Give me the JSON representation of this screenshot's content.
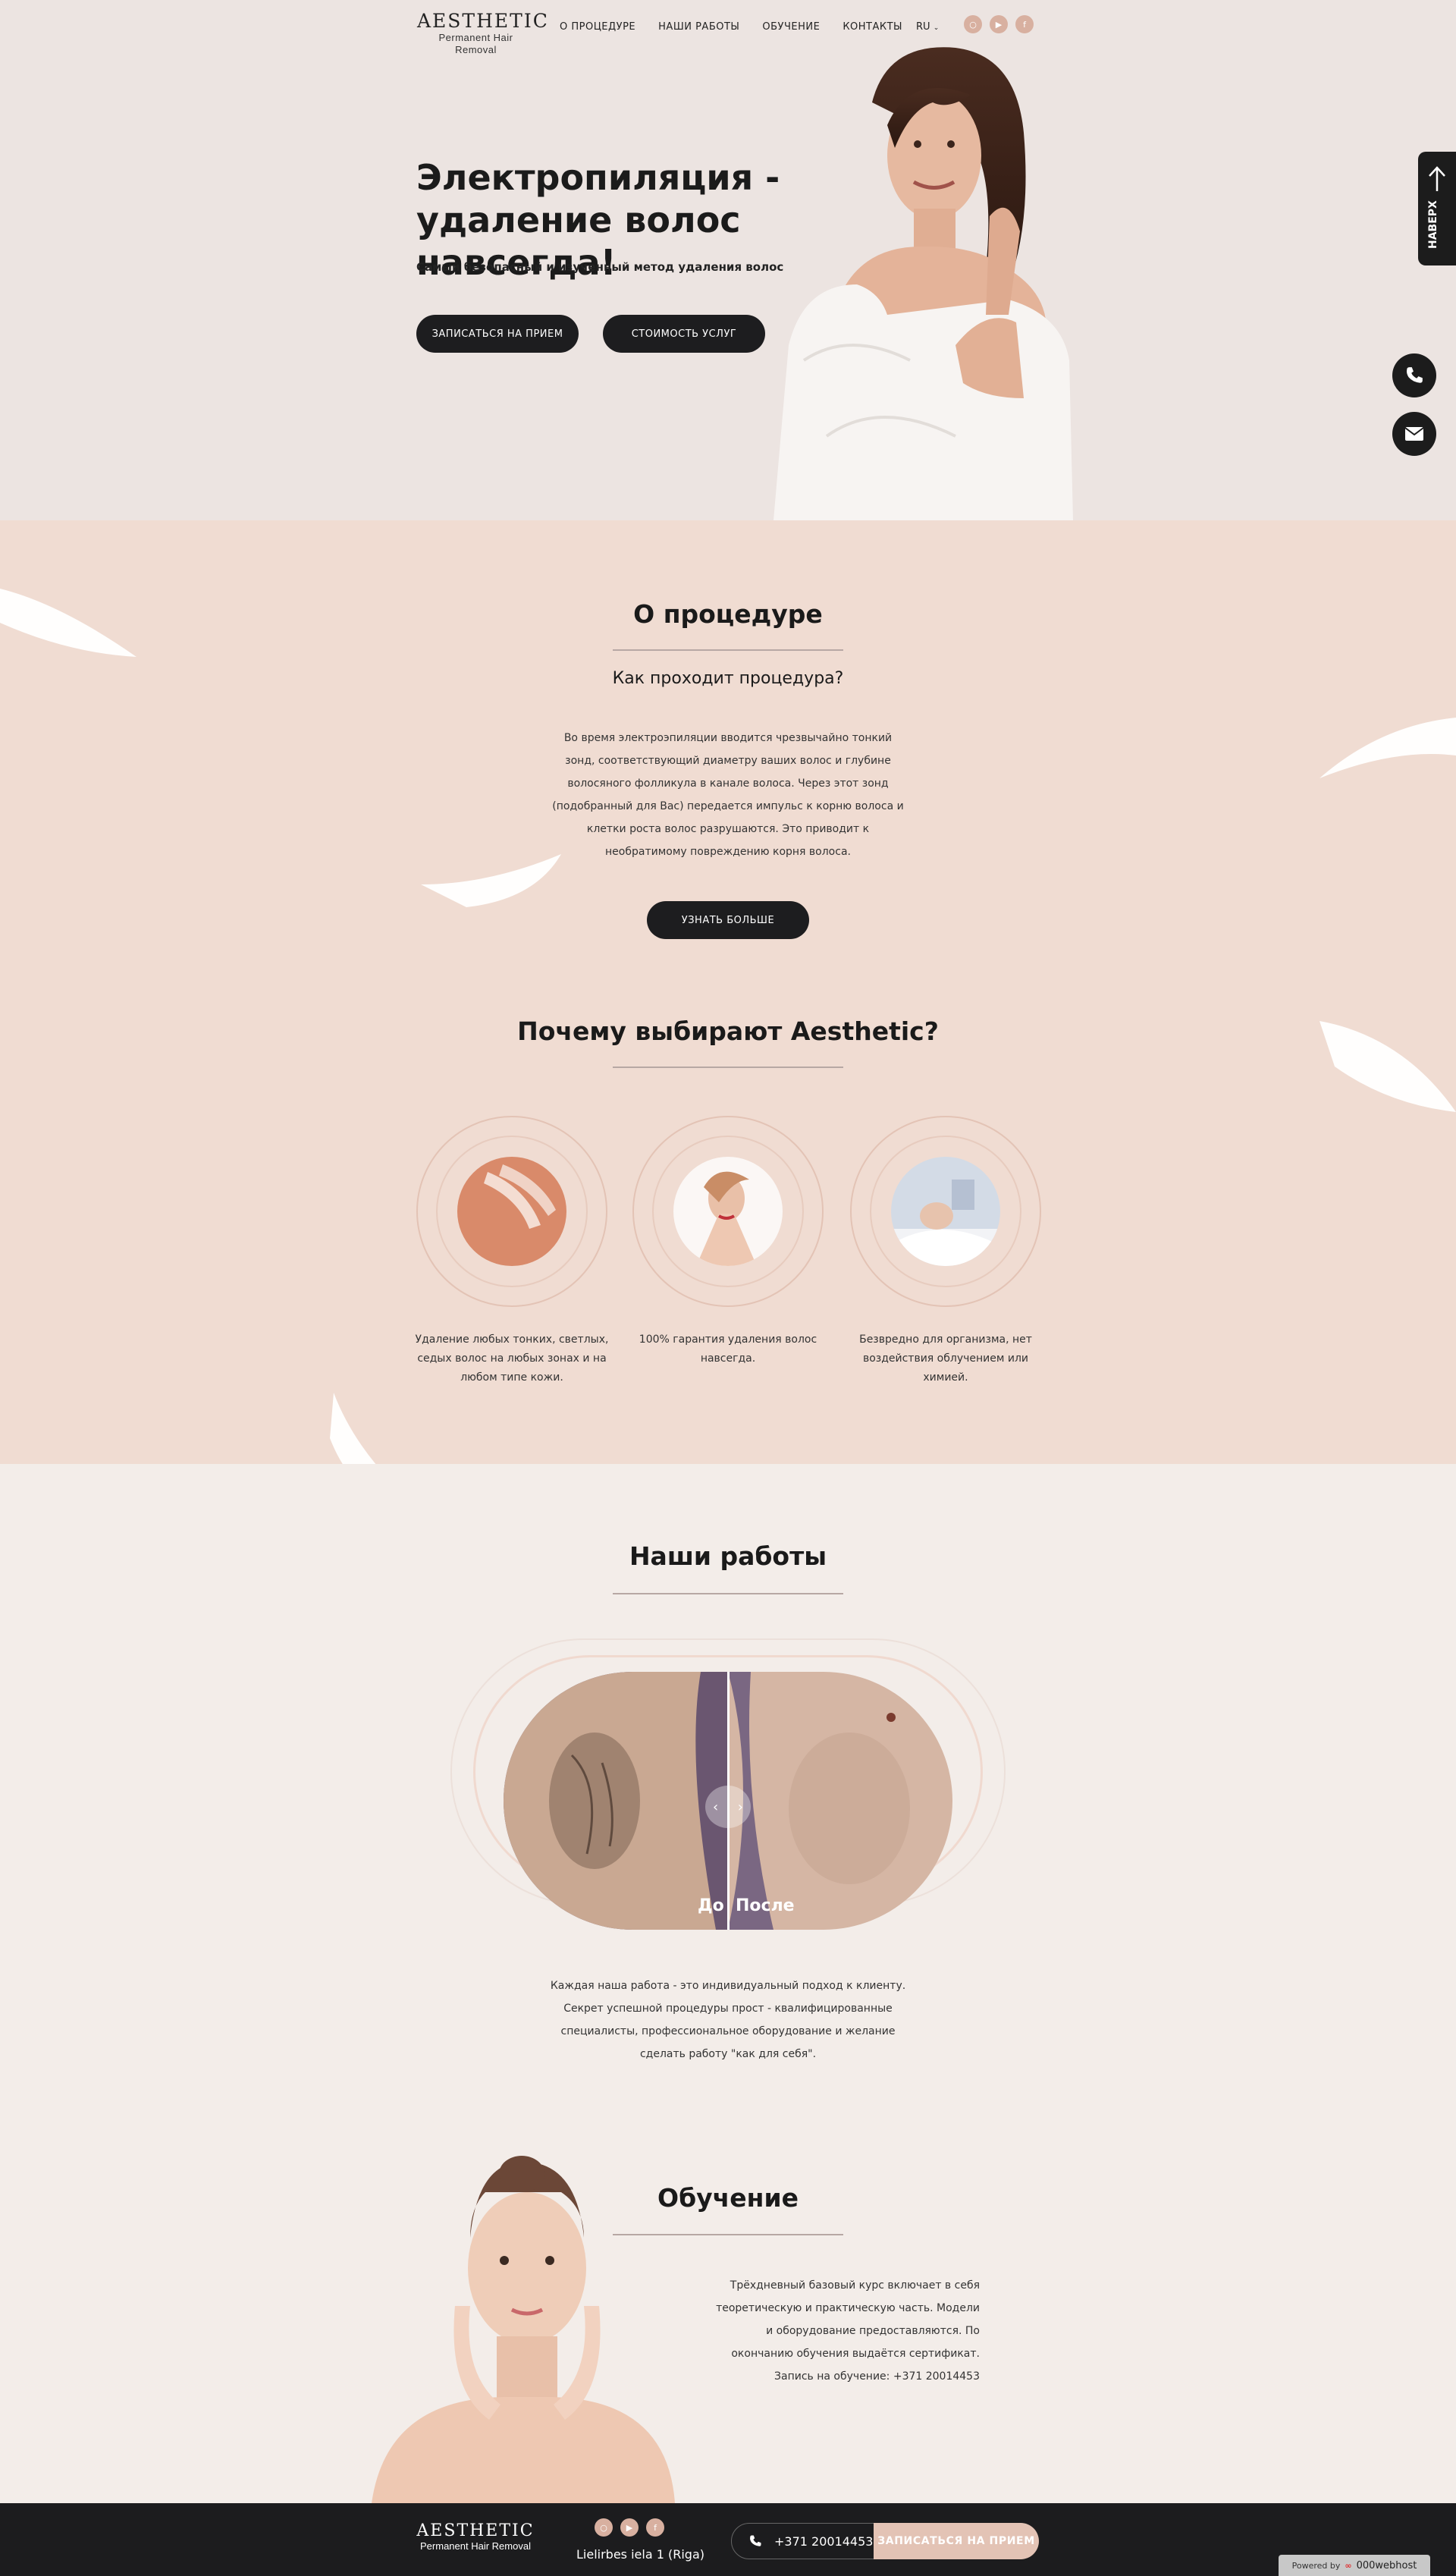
{
  "header": {
    "brand": "AESTHETIC",
    "brand_sub": "Permanent Hair Removal",
    "nav": [
      "О ПРОЦЕДУРЕ",
      "НАШИ РАБОТЫ",
      "ОБУЧЕНИЕ",
      "КОНТАКТЫ"
    ],
    "lang": "RU",
    "social": [
      "instagram-icon",
      "youtube-icon",
      "facebook-icon"
    ]
  },
  "hero": {
    "title_line1": "Электропиляция -",
    "title_line2": "удаление волос навсегда!",
    "subtitle": "Самый безопасный и изученный метод удаления волос",
    "btn_book": "ЗАПИСАТЬСЯ НА ПРИЕМ",
    "btn_prices": "СТОИМОСТЬ УСЛУГ"
  },
  "side": {
    "to_top": "НАВЕРХ",
    "call_icon": "phone-icon",
    "mail_icon": "mail-icon"
  },
  "about": {
    "title": "О процедуре",
    "subtitle": "Как проходит процедура?",
    "lines": [
      "Во время электроэпиляции вводится чрезвычайно тонкий",
      "зонд, соответствующий диаметру ваших волос и глубине",
      "волосяного фолликула в канале волоса. Через этот зонд",
      "(подобранный для Вас) передается импульс к корню волоса и",
      "клетки роста волос разрушаются. Это приводит к",
      "необратимому повреждению корня волоса."
    ],
    "btn_more": "УЗНАТЬ БОЛЬШЕ"
  },
  "why": {
    "title": "Почему выбирают Aesthetic?",
    "items": [
      {
        "lines": [
          "Удаление любых тонких, светлых,",
          "седых волос на любых зонах и на",
          "любом типе кожи."
        ]
      },
      {
        "lines": [
          "100% гарантия удаления волос",
          "навсегда."
        ]
      },
      {
        "lines": [
          "Безвредно для организма, нет",
          "воздействия облучением или",
          "химией."
        ]
      }
    ]
  },
  "works": {
    "title": "Наши работы",
    "before": "До",
    "after": "После",
    "lines": [
      "Каждая наша работа - это индивидуальный подход к клиенту.",
      "Секрет успешной процедуры прост - квалифицированные",
      "специалисты, профессиональное оборудование и желание",
      "сделать работу \"как для себя\"."
    ]
  },
  "training": {
    "title": "Обучение",
    "lines": [
      "Трёхдневный базовый курс включает в себя",
      "теоретическую и практическую часть. Модели",
      "и оборудование предоставляются. По",
      "окончанию обучения выдаётся сертификат.",
      "Запись на обучение: +371 20014453"
    ]
  },
  "footer": {
    "brand": "AESTHETIC",
    "brand_sub": "Permanent Hair Removal",
    "address": "Lielirbes iela 1 (Riga)",
    "phone": "+371 20014453",
    "btn_book": "ЗАПИСАТЬСЯ НА ПРИЕМ",
    "powered_label": "Powered by",
    "powered_brand": "000webhost"
  },
  "colors": {
    "hero_bg": "#ece4e1",
    "about_bg": "#f0dcd2",
    "works_bg": "#f3ede9",
    "accent": "#e3c3b5",
    "dark": "#1d1d1f"
  }
}
